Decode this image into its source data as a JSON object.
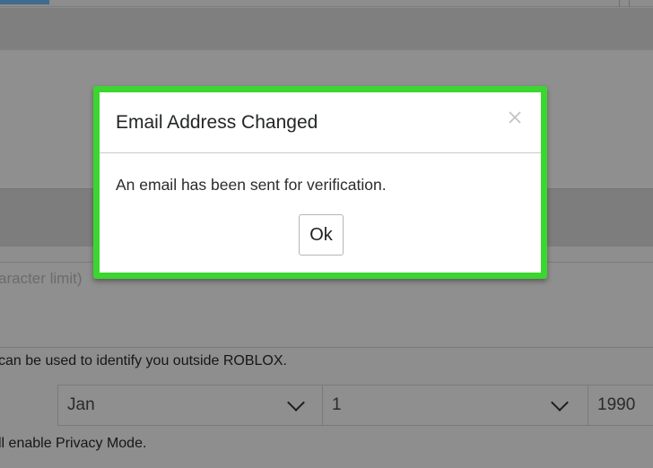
{
  "modal": {
    "title": "Email Address Changed",
    "message": "An email has been sent for verification.",
    "ok_label": "Ok",
    "close_icon": "close-icon",
    "outline_color": "#3bd62f"
  },
  "background": {
    "description_placeholder": "aracter limit)",
    "identity_note": "can be used to identify you outside ROBLOX.",
    "birthday": {
      "month": "Jan",
      "day": "1",
      "year": "1990"
    },
    "privacy_note": "ll enable Privacy Mode.",
    "accent_color": "#3f6c8e"
  }
}
